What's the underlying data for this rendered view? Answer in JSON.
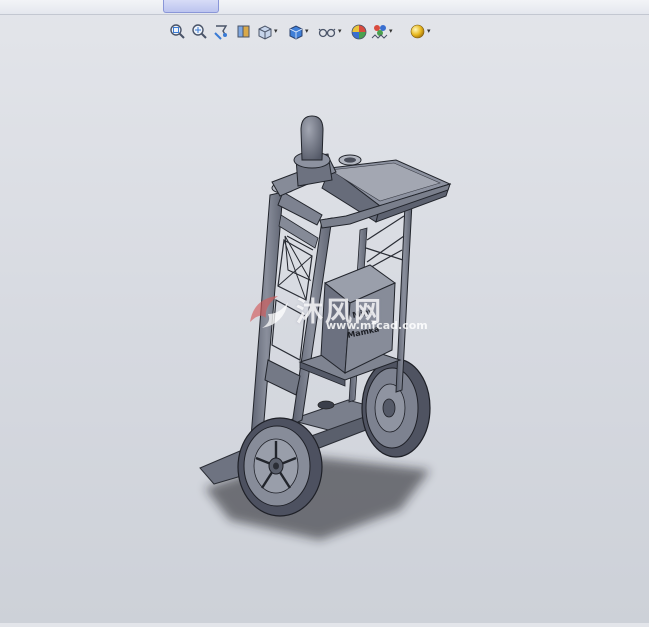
{
  "window": {
    "active_tab_label": ""
  },
  "toolbar": {
    "buttons": [
      {
        "id": "zoom-to-fit",
        "icon": "zoom-to-fit-icon"
      },
      {
        "id": "zoom-to-area",
        "icon": "zoom-to-area-icon"
      },
      {
        "id": "previous-view",
        "icon": "previous-view-icon"
      },
      {
        "id": "section-view",
        "icon": "section-view-icon"
      },
      {
        "id": "view-orientation",
        "icon": "view-orientation-icon",
        "dropdown": true
      },
      {
        "id": "display-style",
        "icon": "display-style-icon",
        "dropdown": true
      },
      {
        "id": "hide-show-items",
        "icon": "hide-show-icon",
        "dropdown": true
      },
      {
        "id": "edit-appearance",
        "icon": "appearance-icon"
      },
      {
        "id": "apply-scene",
        "icon": "scene-icon",
        "dropdown": true
      },
      {
        "id": "view-settings",
        "icon": "view-settings-icon",
        "dropdown": true
      }
    ],
    "dropdown_caret": "▾"
  },
  "viewport": {
    "model": "hand-truck-with-control-stick",
    "model_color": "#6e7381",
    "background_top": "#e3e5ea",
    "background_bottom": "#cdd1d8",
    "box_label_line1": "Mint",
    "box_label_line2": "Mamka"
  },
  "watermark": {
    "main_text": "沐风网",
    "url_text": "www.mfcad.com"
  }
}
